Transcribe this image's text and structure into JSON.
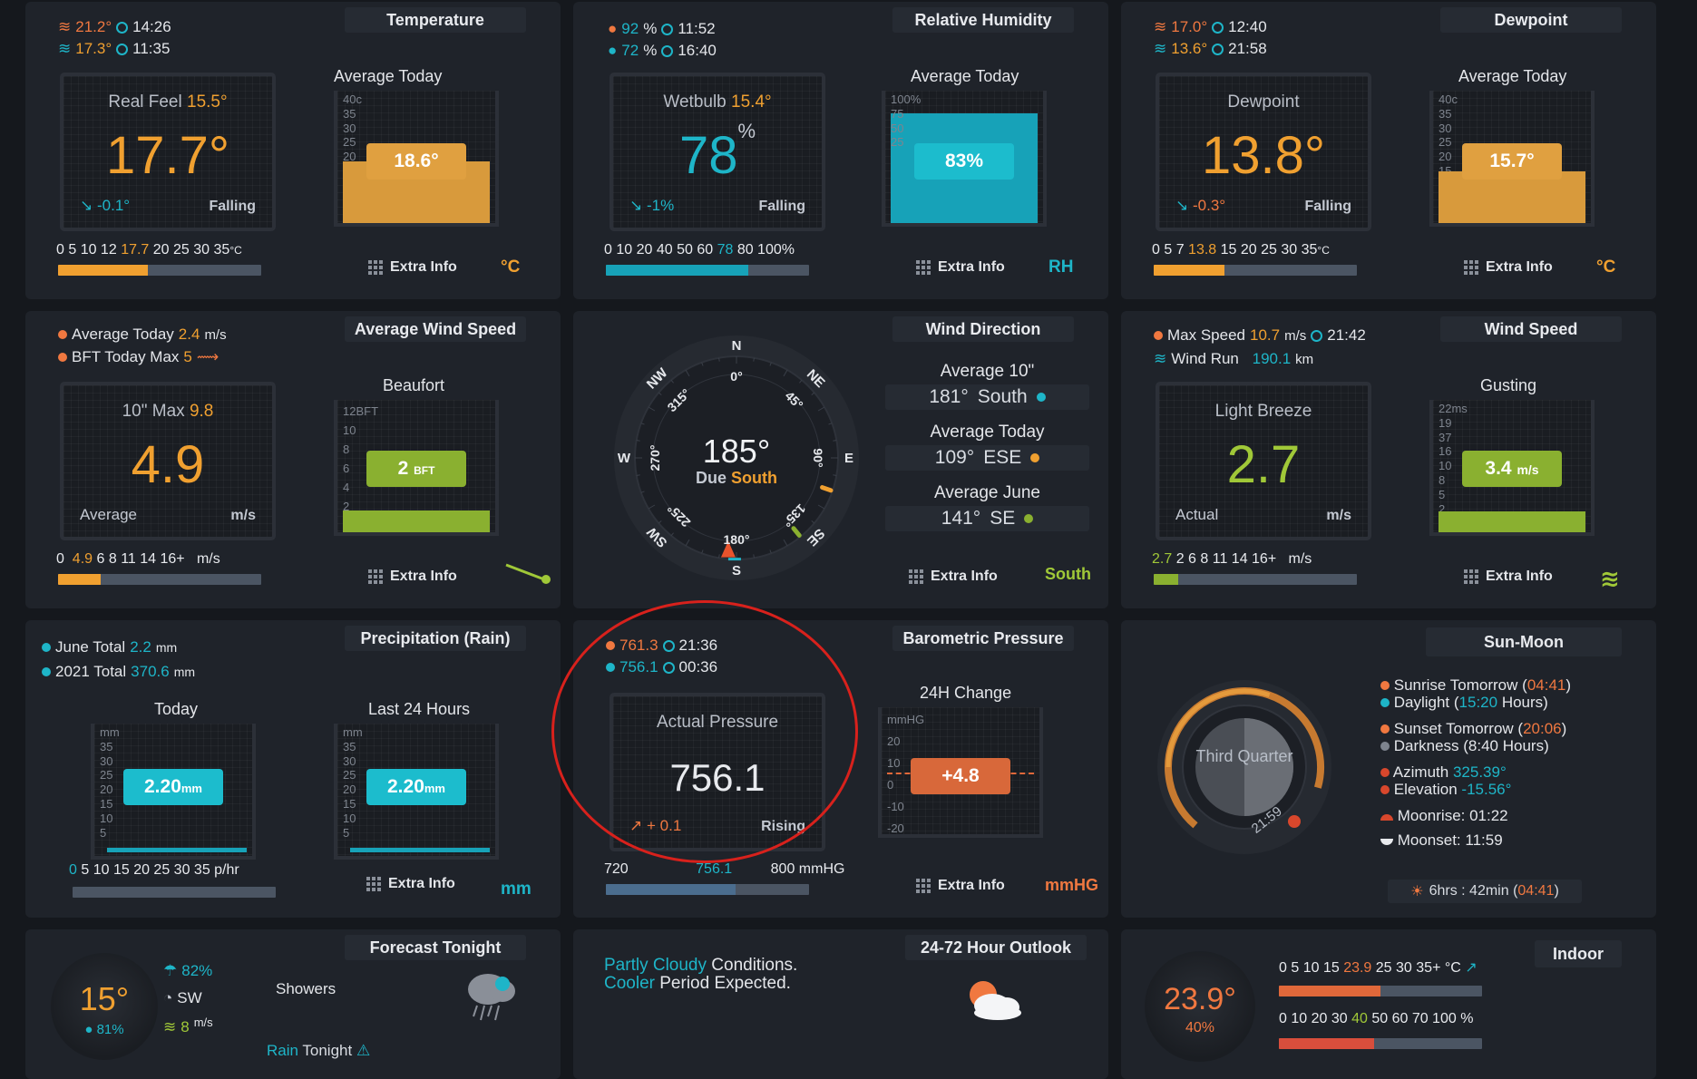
{
  "temperature": {
    "title": "Temperature",
    "high": {
      "value": "21.2°",
      "time": "14:26"
    },
    "low": {
      "value": "17.3°",
      "time": "11:35"
    },
    "gauge": {
      "top_label": "Real Feel",
      "top_value": "15.5°",
      "main": "17.7°",
      "trend": "-0.1°",
      "trend_text": "Falling"
    },
    "avg_title": "Average Today",
    "avg_axis": [
      "40c",
      "35",
      "30",
      "25",
      "20",
      "15",
      "10",
      "5"
    ],
    "avg_value": "18.6°",
    "avg_fraction": 0.465,
    "scale_left": "0 5 10 12",
    "scale_value": "17.7",
    "scale_right": "20 25 30 35",
    "scale_unit": "°C",
    "scale_fraction": 0.44,
    "extra": "Extra Info",
    "unit": "°C"
  },
  "humidity": {
    "title": "Relative Humidity",
    "high": {
      "value": "92",
      "pct": "%",
      "time": "11:52"
    },
    "low": {
      "value": "72",
      "pct": "%",
      "time": "16:40"
    },
    "gauge": {
      "top_label": "Wetbulb",
      "top_value": "15.4°",
      "main": "78",
      "sup": "%",
      "trend": "-1%",
      "trend_text": "Falling"
    },
    "avg_title": "Average Today",
    "avg_axis": [
      "100%",
      "",
      "",
      "75",
      "",
      "50",
      "",
      "25"
    ],
    "avg_value": "83%",
    "avg_fraction": 0.83,
    "scale_left": "0 10 20 40 50 60",
    "scale_value": "78",
    "scale_right": "80 100%",
    "scale_fraction": 0.7,
    "extra": "Extra Info",
    "unit": "RH"
  },
  "dewpoint": {
    "title": "Dewpoint",
    "high": {
      "value": "17.0°",
      "time": "12:40"
    },
    "low": {
      "value": "13.6°",
      "time": "21:58"
    },
    "gauge": {
      "top_label": "Dewpoint",
      "main": "13.8°",
      "trend": "-0.3°",
      "trend_text": "Falling"
    },
    "avg_title": "Average Today",
    "avg_axis": [
      "40c",
      "35",
      "30",
      "25",
      "20",
      "15",
      "10",
      "5"
    ],
    "avg_value": "15.7°",
    "avg_fraction": 0.39,
    "scale_left": "0 5 7",
    "scale_value": "13.8",
    "scale_right": "15 20 25 30 35",
    "scale_unit": "°C",
    "scale_fraction": 0.35,
    "extra": "Extra Info",
    "unit": "°C"
  },
  "avgwind": {
    "title": "Average Wind Speed",
    "line1_label": "Average Today",
    "line1_value": "2.4",
    "line1_unit": "m/s",
    "line2_label": "BFT Today Max",
    "line2_value": "5",
    "gauge": {
      "top_label": "10\" Max",
      "top_value": "9.8",
      "main": "4.9",
      "bl": "Average",
      "br": "m/s"
    },
    "bft_title": "Beaufort",
    "bft_axis": [
      "12BFT",
      "10",
      "8",
      "6",
      "4",
      "2"
    ],
    "bft_value": "2",
    "bft_unit": "BFT",
    "bft_fraction": 0.167,
    "scale_left": "0",
    "scale_value": "4.9",
    "scale_right": "6 8 11 14 16+",
    "scale_unit": "m/s",
    "scale_fraction": 0.21,
    "extra": "Extra Info"
  },
  "winddir": {
    "title": "Wind Direction",
    "compass": {
      "n": "N",
      "ne": "NE",
      "e": "E",
      "se": "SE",
      "s": "S",
      "sw": "SW",
      "w": "W",
      "nw": "NW",
      "d0": "0°",
      "d45": "45°",
      "d90": "90°",
      "d135": "135°",
      "d180": "180°",
      "d225": "225°",
      "d270": "270°",
      "d315": "315°",
      "value": "185°",
      "due": "Due",
      "dir": "South",
      "degrees": 185
    },
    "avg10_label": "Average 10\"",
    "avg10_deg": "181°",
    "avg10_dir": "South",
    "avgday_label": "Average Today",
    "avgday_deg": "109°",
    "avgday_dir": "ESE",
    "avgmonth_label": "Average June",
    "avgmonth_deg": "141°",
    "avgmonth_dir": "SE",
    "extra": "Extra Info",
    "unit": "South"
  },
  "windspeed": {
    "title": "Wind Speed",
    "line1_label": "Max Speed",
    "line1_value": "10.7",
    "line1_unit": "m/s",
    "line1_time": "21:42",
    "line2_label": "Wind Run",
    "line2_value": "190.1",
    "line2_unit": "km",
    "gauge": {
      "top_label": "Light Breeze",
      "main": "2.7",
      "bl": "Actual",
      "br": "m/s"
    },
    "gust_title": "Gusting",
    "gust_axis": [
      "22ms",
      "19",
      "37",
      "16",
      "10",
      "8",
      "5",
      "2"
    ],
    "gust_value": "3.4",
    "gust_unit": "m/s",
    "gust_fraction": 0.16,
    "scale_value": "2.7",
    "scale_right": "2 6 8 11 14 16+",
    "scale_unit": "m/s",
    "scale_fraction": 0.12,
    "extra": "Extra Info"
  },
  "rain": {
    "title": "Precipitation (Rain)",
    "line1_label": "June Total",
    "line1_value": "2.2",
    "line1_unit": "mm",
    "line2_label": "2021 Total",
    "line2_value": "370.6",
    "line2_unit": "mm",
    "today_title": "Today",
    "last24_title": "Last 24 Hours",
    "axis": [
      "mm",
      "35",
      "30",
      "25",
      "20",
      "15",
      "10",
      "5"
    ],
    "today_value": "2.20",
    "last24_value": "2.20",
    "badge_unit": "mm",
    "scale_value": "0",
    "scale_right": "5 10 15 20 25 30 35 p/hr",
    "scale_fraction": 0.0,
    "extra": "Extra Info",
    "unit": "mm"
  },
  "pressure": {
    "title": "Barometric Pressure",
    "high": {
      "value": "761.3",
      "time": "21:36"
    },
    "low": {
      "value": "756.1",
      "time": "00:36"
    },
    "gauge": {
      "top_label": "Actual Pressure",
      "main": "756.1",
      "trend": "+ 0.1",
      "trend_text": "Rising"
    },
    "change_title": "24H Change",
    "change_axis": [
      "mmHG",
      "20",
      "10",
      "0",
      "-10",
      "-20"
    ],
    "change_value": "+4.8",
    "scale_left": "720",
    "scale_value": "756.1",
    "scale_right": "800 mmHG",
    "scale_fraction": 0.64,
    "extra": "Extra Info",
    "unit": "mmHG"
  },
  "sunmoon": {
    "title": "Sun-Moon",
    "moon_phase": "Third Quarter",
    "moon_time": "21:59",
    "sunrise_label": "Sunrise Tomorrow (",
    "sunrise_value": "04:41",
    "sunrise_close": ")",
    "daylight_label": "Daylight (",
    "daylight_value": "15:20",
    "daylight_close": " Hours)",
    "sunset_label": "Sunset Tomorrow (",
    "sunset_value": "20:06",
    "sunset_close": ")",
    "darkness": "Darkness (8:40 Hours)",
    "azimuth_label": "Azimuth",
    "azimuth_value": "325.39°",
    "elevation_label": "Elevation",
    "elevation_value": "-15.56°",
    "moonrise": "Moonrise: 01:22",
    "moonset": "Moonset: 11:59",
    "countdown": "6hrs : 42min (",
    "countdown_value": "04:41",
    "countdown_close": ")"
  },
  "forecast": {
    "title": "Forecast Tonight",
    "temp": "15°",
    "humidity": "81%",
    "rain_pct": "82%",
    "wind_dir": "SW",
    "wind_speed": "8",
    "wind_unit": "m/s",
    "summary": "Showers",
    "rain_word": "Rain",
    "rain_tonight": "Tonight"
  },
  "outlook": {
    "title": "24-72 Hour Outlook",
    "line1_a": "Partly Cloudy",
    "line1_b": " Conditions.",
    "line2_a": "Cooler",
    "line2_b": " Period Expected."
  },
  "indoor": {
    "title": "Indoor",
    "temp": "23.9°",
    "humidity": "40%",
    "temp_scale_left": "0 5 10 15",
    "temp_scale_value": "23.9",
    "temp_scale_right": "25 30 35+ °C",
    "temp_fraction": 0.5,
    "hum_scale_left": "0 10 20 30",
    "hum_scale_value": "40",
    "hum_scale_right": "50 60 70 100 %",
    "hum_fraction": 0.47
  }
}
